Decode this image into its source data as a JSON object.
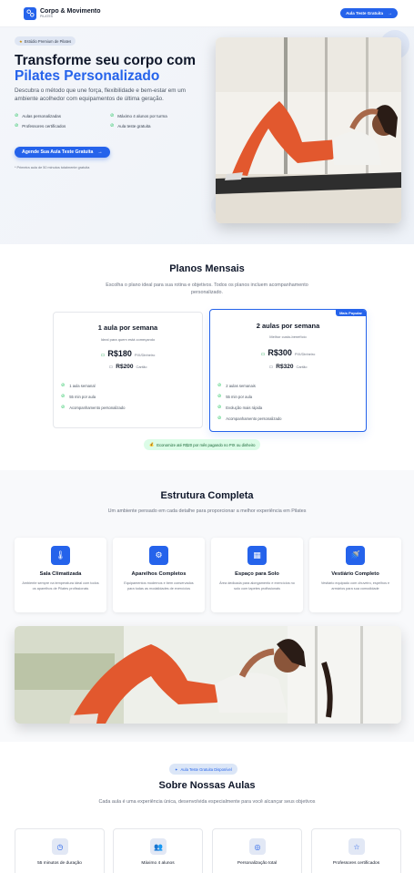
{
  "header": {
    "brand_name": "Corpo & Movimento",
    "brand_sub": "PILATES",
    "cta_label": "Aula Teste Gratuita",
    "cta_arrow": "→"
  },
  "hero": {
    "badge_icon": "★",
    "badge": "Estúdio Premium de Pilates",
    "title_line1": "Transforme seu corpo com",
    "title_line2": "Pilates Personalizado",
    "description": "Descubra o método que une força, flexibilidade e bem-estar em um ambiente acolhedor com equipamentos de última geração.",
    "features": [
      "Aulas personalizadas",
      "Máximo 4 alunos por turma",
      "Professores certificados",
      "Aula teste gratuita"
    ],
    "cta_label": "Agende Sua Aula Teste Gratuita",
    "cta_arrow": "→",
    "note": "* Primeira aula de 50 minutos totalmente gratuita"
  },
  "plans": {
    "title": "Planos Mensais",
    "subtitle": "Escolha o plano ideal para sua rotina e objetivos. Todos os planos incluem acompanhamento personalizado.",
    "cards": [
      {
        "name": "1 aula por semana",
        "tag": "Ideal para quem está começando",
        "price_pix": "R$180",
        "pix_label": "PIX/Dinheiro",
        "price_card": "R$200",
        "card_label": "Cartão",
        "items": [
          "1 aula semanal",
          "55 min por aula",
          "Acompanhamento personalizado"
        ]
      },
      {
        "name": "2 aulas por semana",
        "tag": "Melhor custo-benefício",
        "badge": "Mais Popular",
        "price_pix": "R$300",
        "pix_label": "PIX/Dinheiro",
        "price_card": "R$320",
        "card_label": "Cartão",
        "items": [
          "2 aulas semanais",
          "55 min por aula",
          "Evolução mais rápida",
          "Acompanhamento personalizado"
        ]
      }
    ],
    "savings_icon": "💰",
    "savings": "Economize até R$20 por mês pagando no PIX ou dinheiro"
  },
  "structure": {
    "title": "Estrutura Completa",
    "subtitle": "Um ambiente pensado em cada detalhe para proporcionar a melhor experiência em Pilates",
    "amenities": [
      {
        "icon": "thermometer-icon",
        "glyph": "🌡",
        "title": "Sala Climatizada",
        "desc": "Ambiente sempre na temperatura ideal com todos os aparelhos de Pilates profissionais"
      },
      {
        "icon": "equipment-icon",
        "glyph": "⚙",
        "title": "Aparelhos Completos",
        "desc": "Equipamentos modernos e bem conservados para todas as modalidades de exercícios"
      },
      {
        "icon": "mat-icon",
        "glyph": "▦",
        "title": "Espaço para Solo",
        "desc": "Área dedicada para alongamento e exercícios no solo com tapetes profissionais"
      },
      {
        "icon": "shower-icon",
        "glyph": "🚿",
        "title": "Vestiário Completo",
        "desc": "Vestiário equipado com chuveiro, espelhos e armários para sua comodidade"
      }
    ]
  },
  "about": {
    "badge_icon": "✦",
    "badge": "Aula Teste Gratuita Disponível",
    "title": "Sobre Nossas Aulas",
    "subtitle": "Cada aula é uma experiência única, desenvolvida especialmente para você alcançar seus objetivos",
    "cards": [
      {
        "icon": "clock-icon",
        "glyph": "◷",
        "title": "55 minutos de duração"
      },
      {
        "icon": "users-icon",
        "glyph": "👥",
        "title": "Máximo 4 alunos"
      },
      {
        "icon": "target-icon",
        "glyph": "◎",
        "title": "Personalização total"
      },
      {
        "icon": "star-icon",
        "glyph": "☆",
        "title": "Professores certificados"
      }
    ]
  },
  "colors": {
    "accent": "#2563eb",
    "success": "#22c55e",
    "heading": "#0f172a"
  }
}
